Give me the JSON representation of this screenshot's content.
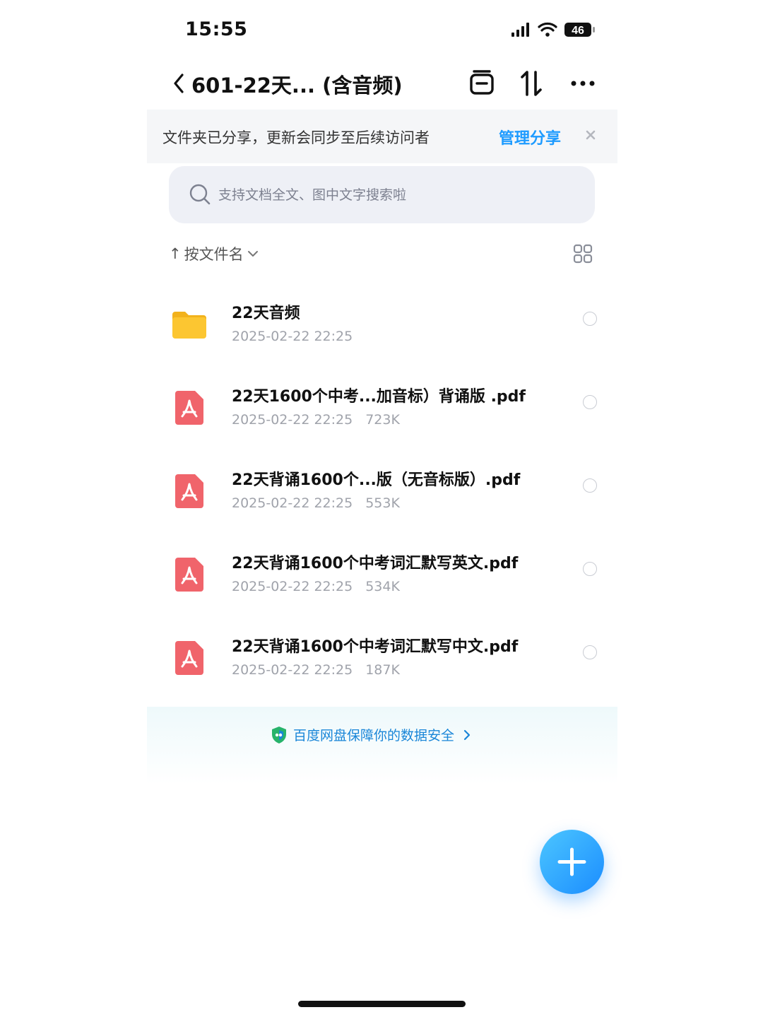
{
  "status_bar": {
    "time": "15:55",
    "battery": "46"
  },
  "header": {
    "title": "601-22天... (含音频)",
    "icons": [
      "back-chevron-icon",
      "archive-icon",
      "sort-transfer-icon",
      "more-icon"
    ]
  },
  "banner": {
    "text": "文件夹已分享，更新会同步至后续访问者",
    "action": "管理分享"
  },
  "search": {
    "placeholder": "支持文档全文、图中文字搜索啦"
  },
  "sort": {
    "arrow": "↑",
    "label": "按文件名"
  },
  "files": [
    {
      "type": "folder",
      "name": "22天音频",
      "date": "2025-02-22 22:25",
      "size": ""
    },
    {
      "type": "pdf",
      "name": "22天1600个中考...加音标）背诵版 .pdf",
      "date": "2025-02-22 22:25",
      "size": "723K"
    },
    {
      "type": "pdf",
      "name": "22天背诵1600个...版（无音标版）.pdf",
      "date": "2025-02-22 22:25",
      "size": "553K"
    },
    {
      "type": "pdf",
      "name": "22天背诵1600个中考词汇默写英文.pdf",
      "date": "2025-02-22 22:25",
      "size": "534K"
    },
    {
      "type": "pdf",
      "name": "22天背诵1600个中考词汇默写中文.pdf",
      "date": "2025-02-22 22:25",
      "size": "187K"
    }
  ],
  "promo": {
    "text": "百度网盘保障你的数据安全"
  },
  "colors": {
    "accent": "#1e9bff",
    "pdf": "#f0646b",
    "folder": "#fbc531"
  }
}
